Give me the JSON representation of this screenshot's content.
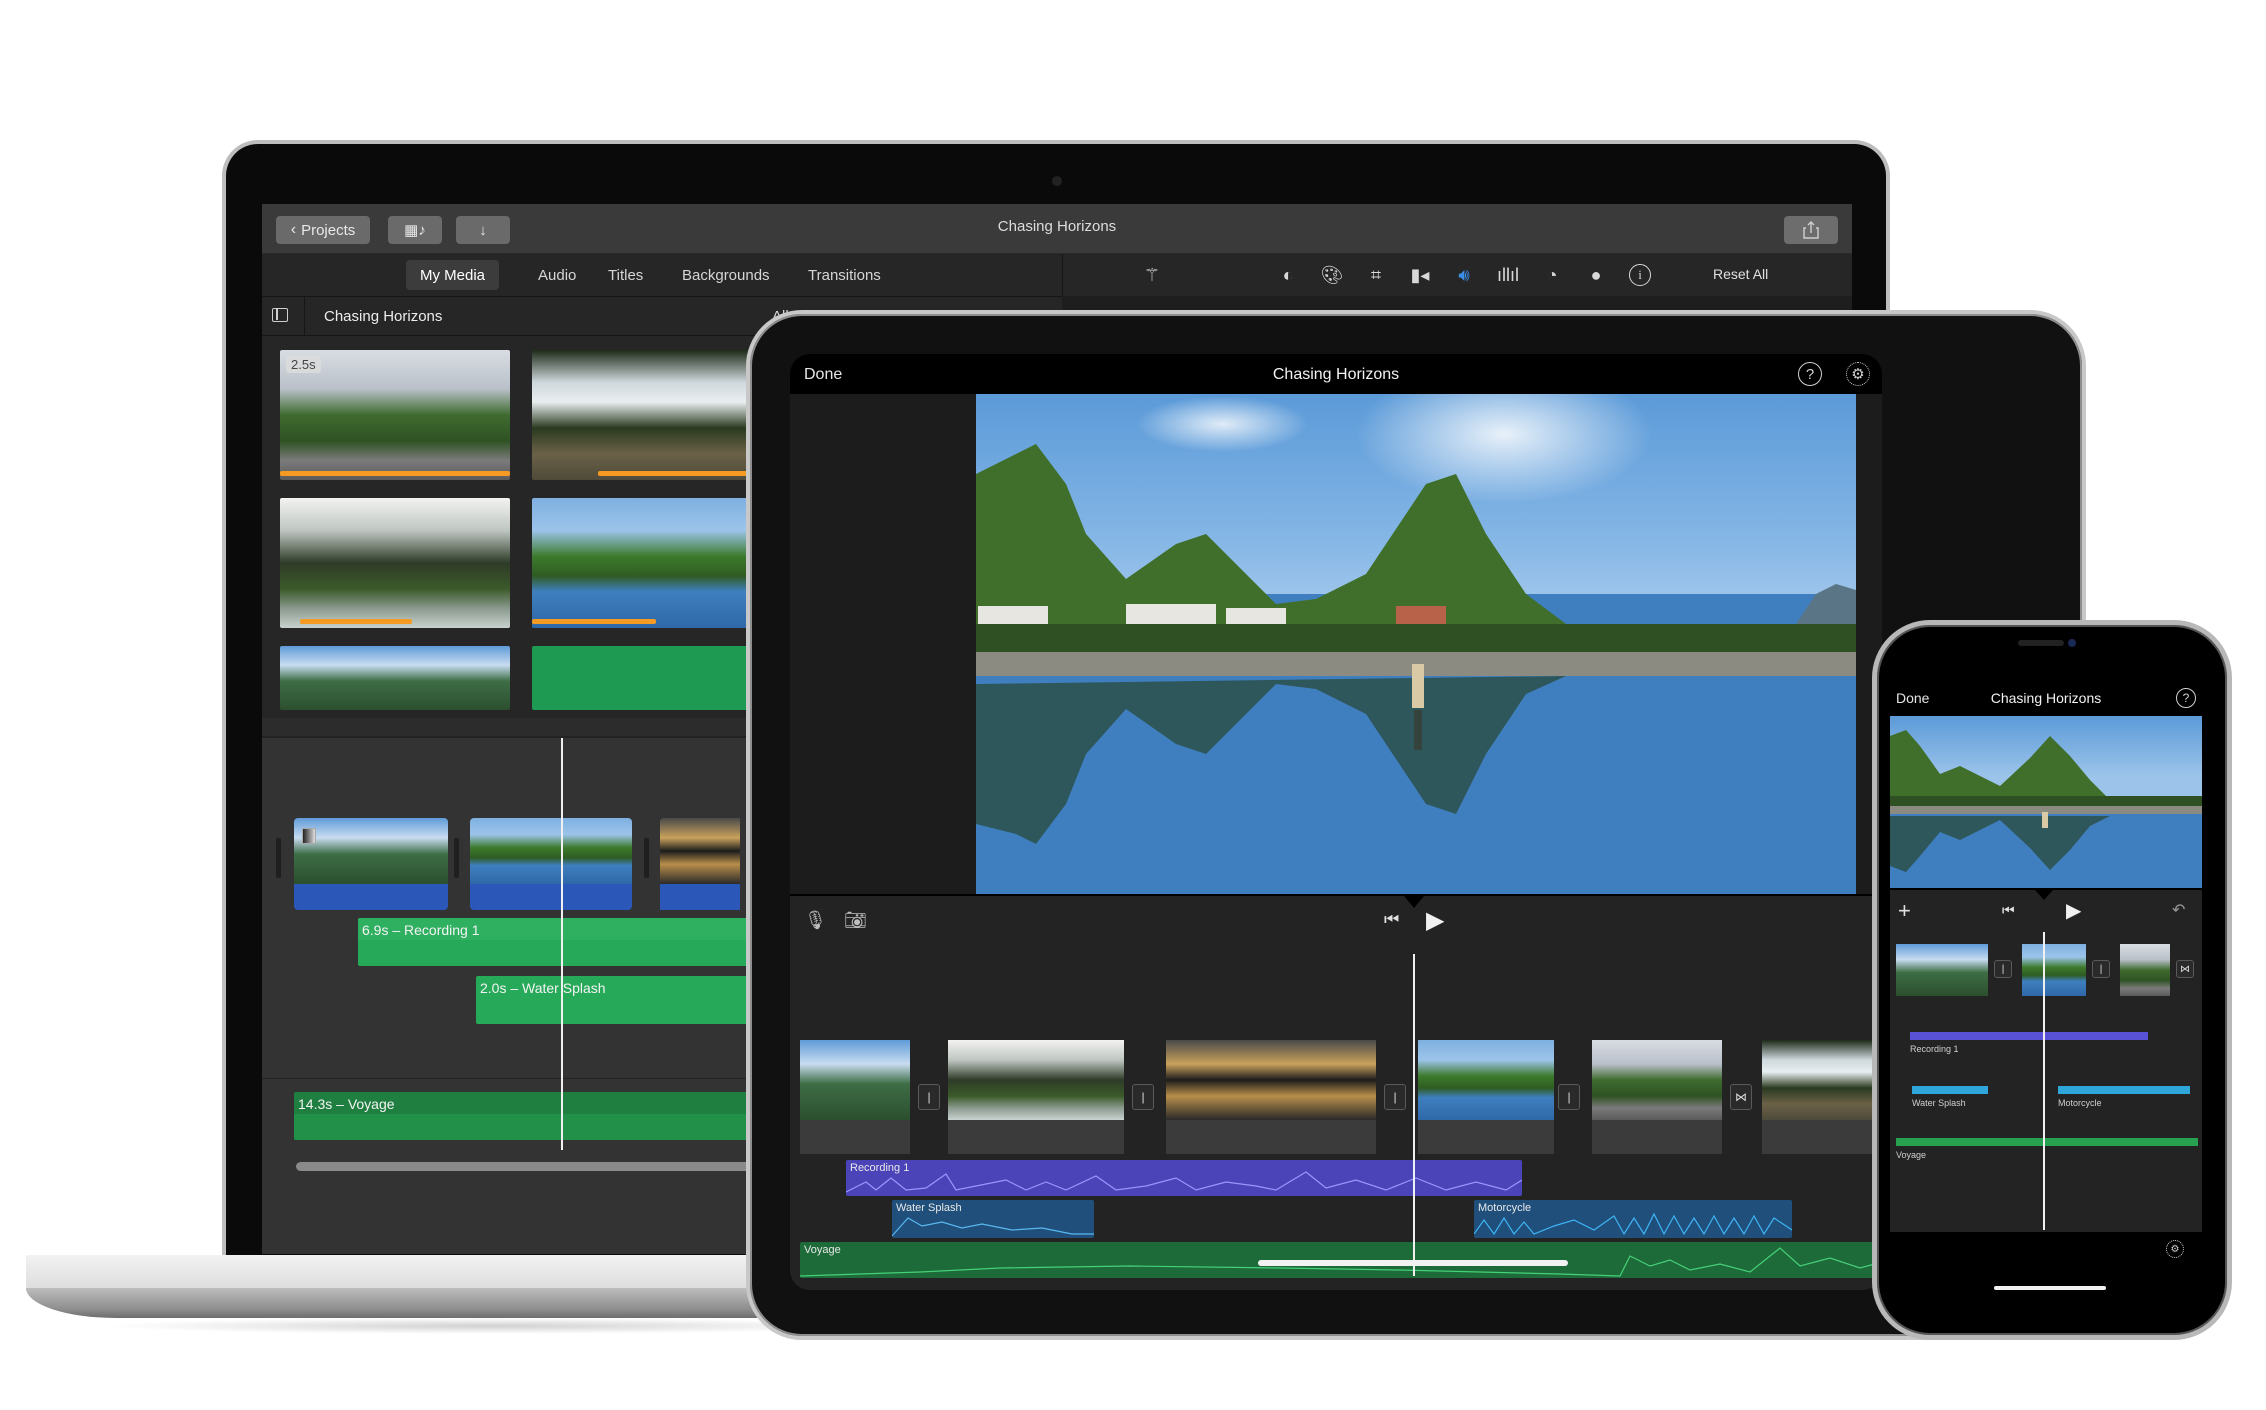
{
  "project_title": "Chasing Horizons",
  "laptop": {
    "toolbar": {
      "projects_label": "Projects",
      "media_audio_toggle_icon": "film-music-icon",
      "import_icon": "download-arrow-icon",
      "share_icon": "share-icon"
    },
    "tabs": [
      {
        "label": "My Media",
        "active": true
      },
      {
        "label": "Audio",
        "active": false
      },
      {
        "label": "Titles",
        "active": false
      },
      {
        "label": "Backgrounds",
        "active": false
      },
      {
        "label": "Transitions",
        "active": false
      }
    ],
    "adjust_tools": [
      {
        "name": "magic-wand-icon"
      },
      {
        "name": "color-balance-icon"
      },
      {
        "name": "color-correction-icon"
      },
      {
        "name": "crop-icon"
      },
      {
        "name": "stabilization-icon"
      },
      {
        "name": "volume-icon",
        "active": true
      },
      {
        "name": "noise-reduction-equalizer-icon"
      },
      {
        "name": "speed-icon"
      },
      {
        "name": "clip-filter-icon"
      },
      {
        "name": "info-icon"
      }
    ],
    "reset_all_label": "Reset All",
    "library": {
      "sidebar_toggle_icon": "sidebar-icon",
      "title": "Chasing Horizons",
      "filter_label": "All C"
    },
    "media_clips": [
      {
        "scene": "road",
        "duration_badge": "2.5s",
        "used": 1.0
      },
      {
        "scene": "trees",
        "used": 0.68
      },
      {
        "scene": "karst",
        "used": 0.5
      },
      {
        "scene": "lake",
        "used": 0.6
      },
      {
        "scene": "valley"
      },
      {
        "scene": "audio"
      }
    ],
    "timeline": {
      "clips": [
        {
          "scene": "valley"
        },
        {
          "scene": "lake"
        },
        {
          "scene": "sunset"
        }
      ],
      "audio": [
        {
          "label": "6.9s – Recording 1",
          "color": "#27a95a"
        },
        {
          "label": "2.0s – Water Splash",
          "color": "#27a95a"
        },
        {
          "label": "14.3s – Voyage",
          "color": "#1f7f40"
        }
      ]
    }
  },
  "tablet": {
    "done_label": "Done",
    "title": "Chasing Horizons",
    "icons": [
      "help-icon",
      "settings-icon",
      "add-icon"
    ],
    "controls": {
      "mic_icon": "microphone-icon",
      "camera_icon": "camera-icon",
      "rewind_icon": "skip-to-start-icon",
      "play_icon": "play-icon"
    },
    "clips": [
      {
        "scene": "valley"
      },
      {
        "scene": "karst"
      },
      {
        "scene": "sunset"
      },
      {
        "scene": "lake"
      },
      {
        "scene": "road"
      },
      {
        "scene": "trees"
      }
    ],
    "audio_tracks": [
      {
        "label": "Recording 1",
        "color": "#4a44b8"
      },
      {
        "label": "Water Splash",
        "color": "#1f4f7a"
      },
      {
        "label": "Motorcycle",
        "color": "#1f4f7a"
      },
      {
        "label": "Voyage",
        "color": "#1d6b38"
      }
    ]
  },
  "phone": {
    "done_label": "Done",
    "title": "Chasing Horizons",
    "help_icon": "help-icon",
    "controls": {
      "add_icon": "add-icon",
      "rewind_icon": "skip-to-start-icon",
      "play_icon": "play-icon",
      "undo_icon": "undo-icon"
    },
    "audio_tracks": [
      {
        "label": "Recording 1",
        "color": "#5a52d6"
      },
      {
        "label": "Water Splash",
        "color": "#2ea6dc"
      },
      {
        "label": "Motorcycle",
        "color": "#2ea6dc"
      },
      {
        "label": "Voyage",
        "color": "#27a04f"
      }
    ],
    "settings_icon": "settings-icon"
  }
}
